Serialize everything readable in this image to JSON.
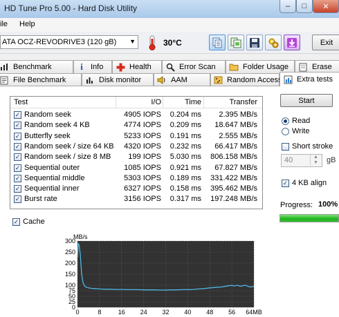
{
  "window": {
    "title": "HD Tune Pro 5.00 - Hard Disk Utility",
    "minimize": "–",
    "maximize": "□",
    "close": "✕"
  },
  "menu": {
    "file": "ile",
    "help": "Help"
  },
  "toolbar": {
    "drive": "ATA   OCZ-REVODRIVE3   (120 gB)",
    "temperature": "30°C",
    "exit": "Exit",
    "icons": [
      "copy-text-icon",
      "copy-screenshot-icon",
      "save-icon",
      "options-icon",
      "download-icon"
    ]
  },
  "tabs_row1": [
    {
      "label": "Benchmark",
      "icon": "benchmark-icon"
    },
    {
      "label": "Info",
      "icon": "info-icon"
    },
    {
      "label": "Health",
      "icon": "health-icon"
    },
    {
      "label": "Error Scan",
      "icon": "error-scan-icon"
    },
    {
      "label": "Folder Usage",
      "icon": "folder-icon"
    },
    {
      "label": "Erase",
      "icon": "erase-icon"
    }
  ],
  "tabs_row2": [
    {
      "label": "File Benchmark",
      "icon": "file-benchmark-icon"
    },
    {
      "label": "Disk monitor",
      "icon": "disk-monitor-icon"
    },
    {
      "label": "AAM",
      "icon": "speaker-icon"
    },
    {
      "label": "Random Access",
      "icon": "random-access-icon"
    },
    {
      "label": "Extra tests",
      "icon": "extra-tests-icon",
      "active": true
    }
  ],
  "table": {
    "headers": {
      "test": "Test",
      "io": "I/O",
      "time": "Time",
      "transfer": "Transfer"
    },
    "rows": [
      {
        "test": "Random seek",
        "io": "4905 IOPS",
        "time": "0.204 ms",
        "transfer": "2.395 MB/s",
        "checked": true
      },
      {
        "test": "Random seek 4 KB",
        "io": "4774 IOPS",
        "time": "0.209 ms",
        "transfer": "18.647 MB/s",
        "checked": true
      },
      {
        "test": "Butterfly seek",
        "io": "5233 IOPS",
        "time": "0.191 ms",
        "transfer": "2.555 MB/s",
        "checked": true
      },
      {
        "test": "Random seek / size 64 KB",
        "io": "4320 IOPS",
        "time": "0.232 ms",
        "transfer": "66.417 MB/s",
        "checked": true
      },
      {
        "test": "Random seek / size 8 MB",
        "io": "199 IOPS",
        "time": "5.030 ms",
        "transfer": "806.158 MB/s",
        "checked": true
      },
      {
        "test": "Sequential outer",
        "io": "1085 IOPS",
        "time": "0.921 ms",
        "transfer": "67.827 MB/s",
        "checked": true
      },
      {
        "test": "Sequential middle",
        "io": "5303 IOPS",
        "time": "0.189 ms",
        "transfer": "331.422 MB/s",
        "checked": true
      },
      {
        "test": "Sequential inner",
        "io": "6327 IOPS",
        "time": "0.158 ms",
        "transfer": "395.462 MB/s",
        "checked": true
      },
      {
        "test": "Burst rate",
        "io": "3156 IOPS",
        "time": "0.317 ms",
        "transfer": "197.248 MB/s",
        "checked": true
      }
    ]
  },
  "controls": {
    "start": "Start",
    "read": "Read",
    "write": "Write",
    "mode_selected": "read",
    "short_stroke": "Short stroke",
    "short_stroke_checked": false,
    "size_value": "40",
    "size_unit": "gB",
    "align_4kb": "4 KB align",
    "align_checked": true,
    "progress_label": "Progress:",
    "progress_text": "100%",
    "progress_value": 1.0,
    "cache": "Cache",
    "cache_checked": true,
    "check_mark": "✓"
  },
  "chart_data": {
    "type": "line",
    "ylabel": "MB/s",
    "xlabel": "",
    "ylim": [
      0,
      300
    ],
    "xlim": [
      0,
      64
    ],
    "y_ticks": [
      0,
      25,
      50,
      75,
      100,
      150,
      200,
      250,
      300
    ],
    "x_ticks": [
      0,
      8,
      16,
      24,
      32,
      40,
      48,
      56,
      64
    ],
    "x_tick_labels": [
      "0",
      "8",
      "16",
      "24",
      "32",
      "40",
      "48",
      "56",
      "64MB"
    ],
    "grid": true,
    "line_color": "#4fb8e6",
    "background": "#323232",
    "series": [
      {
        "x": [
          0,
          0.3,
          0.6,
          1,
          1.5,
          2,
          2.5,
          3,
          4,
          5,
          6,
          8,
          10,
          12,
          14,
          16,
          18,
          20,
          22,
          24,
          26,
          28,
          30,
          32,
          34,
          36,
          38,
          40,
          42,
          44,
          46,
          48,
          50,
          52,
          54,
          55,
          56,
          57,
          58,
          59,
          60,
          61,
          62,
          63,
          64
        ],
        "y": [
          225,
          290,
          282,
          240,
          150,
          112,
          98,
          92,
          88,
          86,
          85,
          83,
          82,
          82,
          81,
          81,
          80,
          80,
          80,
          79,
          79,
          79,
          78,
          78,
          79,
          79,
          80,
          80,
          81,
          83,
          85,
          88,
          90,
          92,
          96,
          98,
          99,
          97,
          100,
          95,
          98,
          100,
          94,
          92,
          96
        ]
      }
    ]
  }
}
